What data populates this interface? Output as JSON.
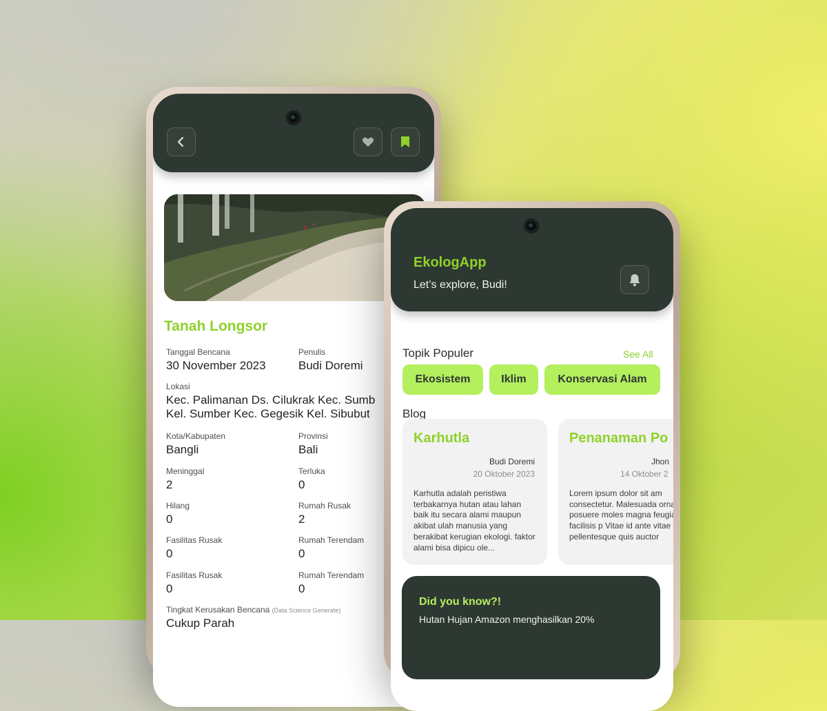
{
  "detail": {
    "title": "Tanah Longsor",
    "fields": {
      "tanggal_label": "Tanggal Bencana",
      "tanggal_value": "30 November 2023",
      "penulis_label": "Penulis",
      "penulis_value": "Budi Doremi",
      "lokasi_label": "Lokasi",
      "lokasi_line1": "Kec. Palimanan  Ds. Cilukrak  Kec. Sumb",
      "lokasi_line2": "Kel. Sumber  Kec. Gegesik  Kel. Sibubut",
      "kota_label": "Kota/Kabupaten",
      "kota_value": "Bangli",
      "provinsi_label": "Provinsi",
      "provinsi_value": "Bali",
      "meninggal_label": "Meninggal",
      "meninggal_value": "2",
      "terluka_label": "Terluka",
      "terluka_value": "0",
      "hilang_label": "Hilang",
      "hilang_value": "0",
      "rumah_rusak_label": "Rumah Rusak",
      "rumah_rusak_value": "2",
      "fasilitas_rusak_label": "Fasilitas Rusak",
      "fasilitas_rusak_value": "0",
      "rumah_terendam_label": "Rumah Terendam",
      "rumah_terendam_value": "0",
      "fasilitas_rusak2_label": "Fasilitas Rusak",
      "fasilitas_rusak2_value": "0",
      "rumah_terendam2_label": "Rumah Terendam",
      "rumah_terendam2_value": "0",
      "tingkat_label": "Tingkat Kerusakan Bencana",
      "tingkat_note": "(Data Science Generate)",
      "tingkat_value": "Cukup Parah"
    }
  },
  "home": {
    "app_title": "EkologApp",
    "greeting": "Let’s explore, Budi!",
    "topics_title": "Topik Populer",
    "see_all": "See All",
    "topics": [
      "Ekosistem",
      "Iklim",
      "Konservasi Alam"
    ],
    "blog_title": "Blog",
    "blogs": [
      {
        "title": "Karhutla",
        "author": "Budi Doremi",
        "date": "20 Oktober 2023",
        "excerpt": "Karhutla adalah peristiwa terbakarnya hutan atau lahan baik itu secara alami maupun akibat ulah manusia yang berakibat kerugian ekologi. faktor alami bisa dipicu ole..."
      },
      {
        "title": "Penanaman Po",
        "author": "Jhon",
        "date": "14 Oktober 2",
        "excerpt": "Lorem ipsum dolor sit am consectetur. Malesuada ornare sit posuere moles magna feugiat facilisis p Vitae id ante vitae pellentesque quis auctor"
      }
    ],
    "did_you_know": {
      "title": "Did you know?!",
      "text": "Hutan Hujan Amazon menghasilkan 20%"
    }
  },
  "colors": {
    "accent": "#8fd12c",
    "chip": "#b4ef5e",
    "dark": "#2e3832"
  },
  "icons": [
    "back-arrow-icon",
    "heart-icon",
    "bookmark-icon",
    "bell-icon"
  ]
}
